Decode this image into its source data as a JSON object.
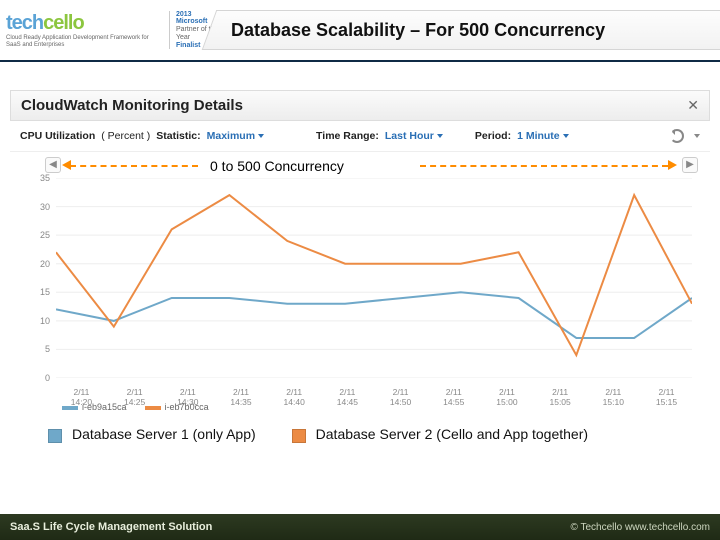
{
  "header": {
    "logo_main_a": "tech",
    "logo_main_b": "cello",
    "logo_sub": "Cloud Ready Application Development Framework for SaaS and Enterprises",
    "award_line1": "2013 Microsoft",
    "award_line2": "Partner of the Year",
    "award_line3": "Finalist",
    "title": "Database Scalability – For 500 Concurrency"
  },
  "cloudwatch": {
    "panel_title": "CloudWatch Monitoring Details",
    "close": "✕",
    "metric_name": "CPU Utilization",
    "metric_unit": "( Percent )",
    "statistic_label": "Statistic:",
    "statistic_value": "Maximum",
    "timerange_label": "Time Range:",
    "timerange_value": "Last Hour",
    "period_label": "Period:",
    "period_value": "1 Minute",
    "legend_a": "i-eb9a15ca",
    "legend_b": "i-eb7b0cca"
  },
  "annotation": {
    "range_text": "0 to 500 Concurrency",
    "step_left": "◀",
    "step_right": "▶"
  },
  "chart_data": {
    "type": "line",
    "xlabel": "",
    "ylabel": "",
    "ylim": [
      0,
      35
    ],
    "yticks": [
      0,
      5,
      10,
      15,
      20,
      25,
      30,
      35
    ],
    "categories": [
      "2/11 14:20",
      "2/11 14:25",
      "2/11 14:30",
      "2/11 14:35",
      "2/11 14:40",
      "2/11 14:45",
      "2/11 14:50",
      "2/11 14:55",
      "2/11 15:00",
      "2/11 15:05",
      "2/11 15:10",
      "2/11 15:15"
    ],
    "series": [
      {
        "name": "i-eb9a15ca",
        "color": "#6fa8c9",
        "values": [
          12,
          10,
          14,
          14,
          13,
          13,
          14,
          15,
          14,
          7,
          7,
          14
        ]
      },
      {
        "name": "i-eb7b0cca",
        "color": "#ec8b44",
        "values": [
          22,
          9,
          26,
          32,
          24,
          20,
          20,
          20,
          22,
          4,
          32,
          13
        ]
      }
    ]
  },
  "slide_legend": {
    "a": "Database Server 1 (only App)",
    "b": "Database Server 2 (Cello and App together)"
  },
  "footer": {
    "left": "Saa.S Life Cycle Management Solution",
    "right": "© Techcello www.techcello.com"
  }
}
